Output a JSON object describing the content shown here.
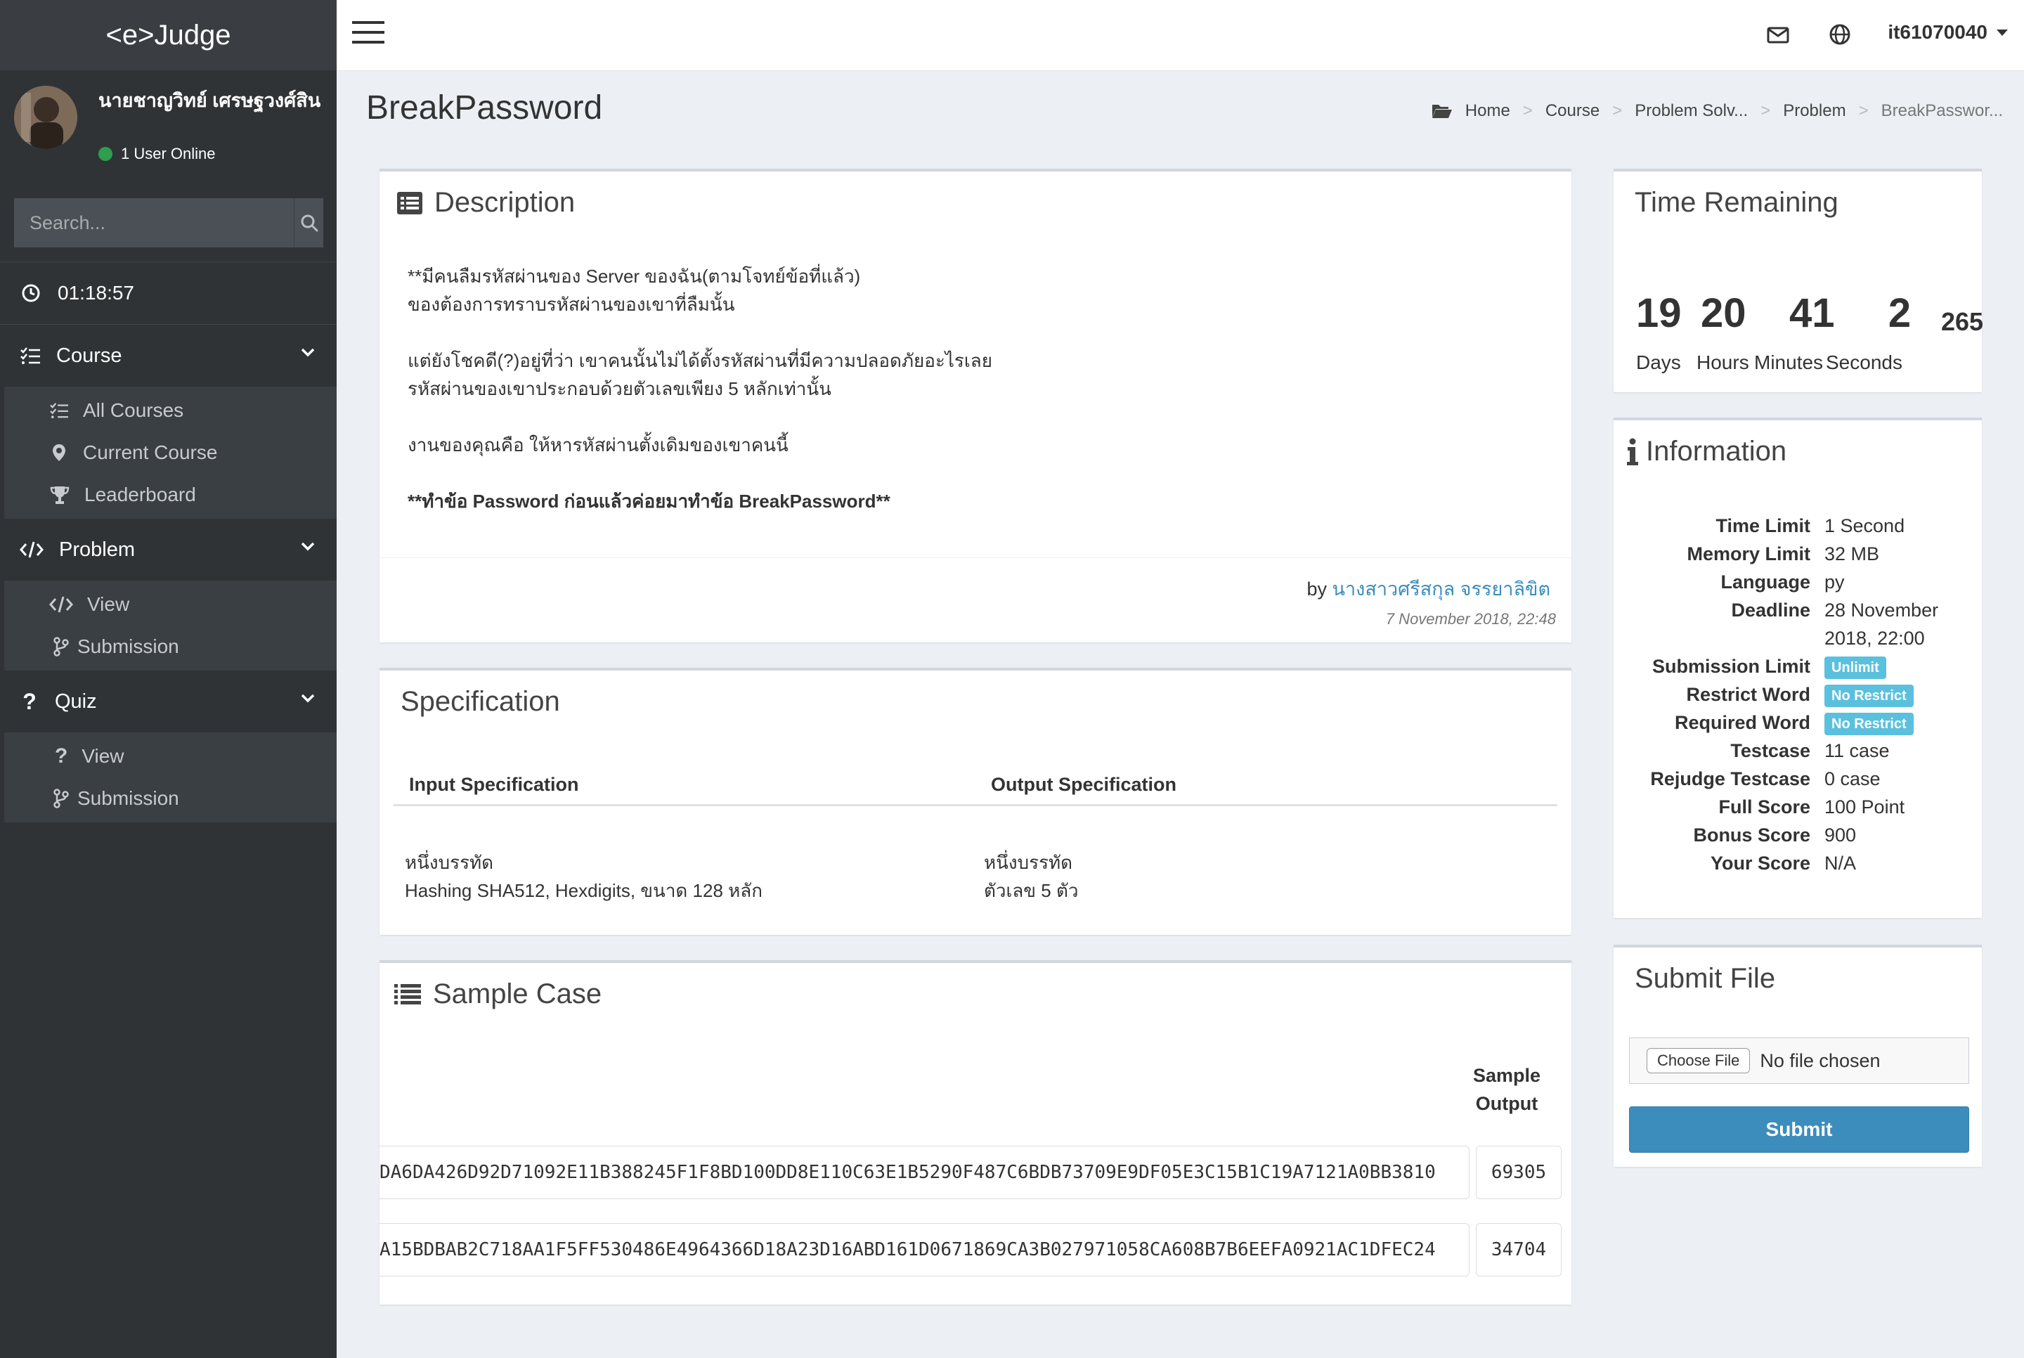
{
  "app": {
    "brand": "<e>Judge"
  },
  "user": {
    "name": "นายชาญวิทย์ เศรษฐวงศ์สิน",
    "status": "1 User Online",
    "username": "it61070040"
  },
  "search": {
    "placeholder": "Search..."
  },
  "sidebar": {
    "timer": "01:18:57",
    "sections": [
      {
        "label": "Course",
        "items": [
          "All Courses",
          "Current Course",
          "Leaderboard"
        ]
      },
      {
        "label": "Problem",
        "items": [
          "View",
          "Submission"
        ]
      },
      {
        "label": "Quiz",
        "items": [
          "View",
          "Submission"
        ]
      }
    ]
  },
  "page": {
    "title": "BreakPassword"
  },
  "breadcrumb": [
    "Home",
    "Course",
    "Problem Solv...",
    "Problem",
    "BreakPasswor..."
  ],
  "description": {
    "title": "Description",
    "lines": [
      "**มีคนลืมรหัสผ่านของ Server ของฉัน(ตามโจทย์ข้อที่แล้ว)",
      "ของต้องการทราบรหัสผ่านของเขาที่ลืมนั้น",
      "แต่ยังโชคดี(?)อยู่ที่ว่า เขาคนนั้นไม่ได้ตั้งรหัสผ่านที่มีความปลอดภัยอะไรเลย",
      "รหัสผ่านของเขาประกอบด้วยตัวเลขเพียง 5 หลักเท่านั้น",
      "งานของคุณคือ ให้หารหัสผ่านตั้งเดิมของเขาคนนี้",
      "**ทำข้อ Password ก่อนแล้วค่อยมาทำข้อ BreakPassword**"
    ],
    "by_label": "by",
    "author": "นางสาวศรีสกุล จรรยาลิขิต",
    "date": "7 November 2018, 22:48"
  },
  "specification": {
    "title": "Specification",
    "input_header": "Input Specification",
    "output_header": "Output Specification",
    "input_lines": [
      "หนึ่งบรรทัด",
      "Hashing SHA512, Hexdigits, ขนาด 128 หลัก"
    ],
    "output_lines": [
      "หนึ่งบรรทัด",
      "ตัวเลข 5 ตัว"
    ]
  },
  "sample": {
    "title": "Sample Case",
    "output_header_line1": "Sample",
    "output_header_line2": "Output",
    "rows": [
      {
        "input": "DA6DA426D92D71092E11B388245F1F8BD100DD8E110C63E1B5290F487C6BDB73709E9DF05E3C15B1C19A7121A0BB3810",
        "output": "69305"
      },
      {
        "input": "A15BDBAB2C718AA1F5FF530486E4964366D18A23D16ABD161D0671869CA3B027971058CA608B7B6EEFA0921AC1DFEC24",
        "output": "34704"
      }
    ]
  },
  "time_remaining": {
    "title": "Time Remaining",
    "days": "19",
    "hours": "20",
    "minutes": "41",
    "seconds": "2",
    "ms": "265",
    "labels": [
      "Days",
      "Hours",
      "Minutes",
      "Seconds"
    ]
  },
  "information": {
    "title": "Information",
    "rows": [
      {
        "key": "Time Limit",
        "value": "1 Second"
      },
      {
        "key": "Memory Limit",
        "value": "32 MB"
      },
      {
        "key": "Language",
        "value": "py"
      },
      {
        "key": "Deadline",
        "value": "28 November 2018, 22:00"
      },
      {
        "key": "Submission Limit",
        "badge": "Unlimit"
      },
      {
        "key": "Restrict Word",
        "badge": "No Restrict"
      },
      {
        "key": "Required Word",
        "badge": "No Restrict"
      },
      {
        "key": "Testcase",
        "value": "11 case"
      },
      {
        "key": "Rejudge Testcase",
        "value": "0 case"
      },
      {
        "key": "Full Score",
        "value": "100 Point"
      },
      {
        "key": "Bonus Score",
        "value": "900"
      },
      {
        "key": "Your Score",
        "value": "N/A"
      }
    ]
  },
  "submit": {
    "title": "Submit File",
    "choose_label": "Choose File",
    "file_status": "No file chosen",
    "button": "Submit"
  },
  "colors": {
    "sidebar": "#2f3336",
    "accent": "#3c8dbc",
    "badge": "#5bc0de",
    "online": "#2e9e4f"
  },
  "icons": [
    "clock-icon",
    "list-check-icon",
    "code-icon",
    "question-icon",
    "search-icon",
    "mail-icon",
    "globe-icon",
    "folder-open-icon",
    "info-icon",
    "list-icon"
  ]
}
